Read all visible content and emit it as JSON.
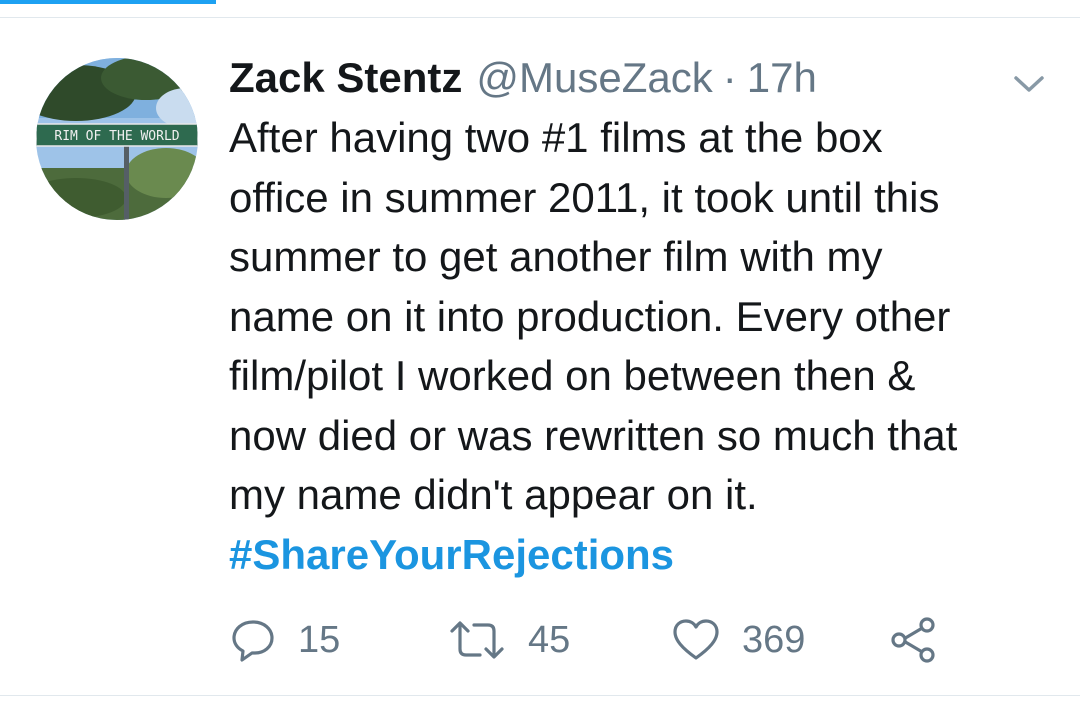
{
  "tweet": {
    "author_name": "Zack Stentz",
    "handle": "@MuseZack",
    "separator": "·",
    "timestamp": "17h",
    "avatar_sign_text": "RIM OF THE WORLD",
    "text_lines": [
      "After having two #1 films at the box",
      "office in summer 2011, it took until this",
      "summer to get another film with my",
      "name on it into production. Every other",
      "film/pilot I worked on between then &",
      "now died or was rewritten so much that",
      "my name didn't appear on it."
    ],
    "hashtag": "#ShareYourRejections",
    "actions": {
      "reply_count": "15",
      "retweet_count": "45",
      "like_count": "369"
    }
  },
  "icons": {
    "more": "chevron-down-icon",
    "reply": "reply-icon",
    "retweet": "retweet-icon",
    "like": "heart-icon",
    "share": "share-icon"
  },
  "colors": {
    "accent": "#1da1f2",
    "hashtag": "#1b95e0",
    "text": "#14171a",
    "secondary": "#657786",
    "divider": "#e1e8ed"
  }
}
